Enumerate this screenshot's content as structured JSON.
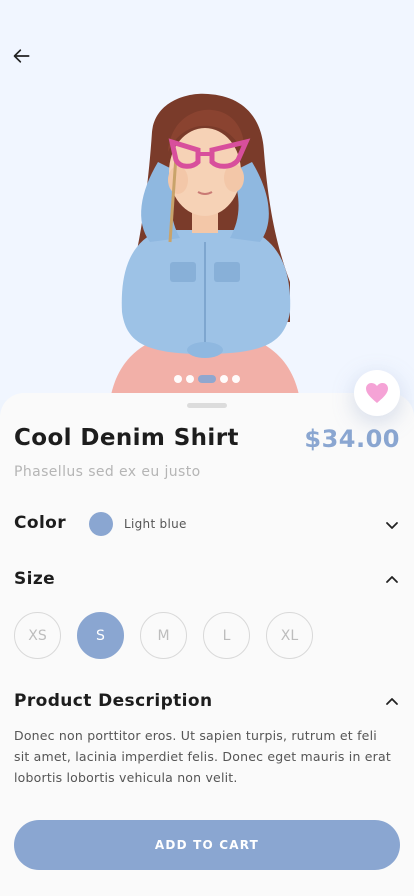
{
  "colors": {
    "accent": "#8aa6d1",
    "heart": "#f5a3d6"
  },
  "header": {
    "back_icon": "arrow-left-icon"
  },
  "gallery": {
    "image_count": 5,
    "active_index": 2
  },
  "product": {
    "title": "Cool Denim Shirt",
    "price": "$34.00",
    "subtitle": "Phasellus sed ex eu justo"
  },
  "color_option": {
    "label": "Color",
    "selected_name": "Light blue",
    "selected_hex": "#8aa6d1",
    "expanded": false
  },
  "size_option": {
    "label": "Size",
    "expanded": true,
    "sizes": [
      "XS",
      "S",
      "M",
      "L",
      "XL"
    ],
    "selected": "S"
  },
  "description": {
    "label": "Product Description",
    "expanded": true,
    "text": "Donec non porttitor eros. Ut sapien turpis, rutrum et feli sit amet, lacinia imperdiet felis. Donec eget mauris in erat lobortis lobortis vehicula non velit."
  },
  "cta": {
    "label": "ADD TO CART"
  }
}
